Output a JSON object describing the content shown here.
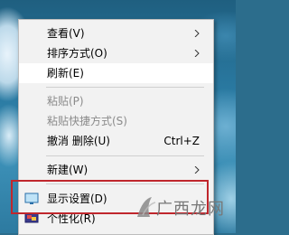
{
  "context_menu": {
    "items": [
      {
        "label": "查看(V)",
        "submenu": true
      },
      {
        "label": "排序方式(O)",
        "submenu": true
      },
      {
        "label": "刷新(E)"
      },
      {
        "label": "粘贴(P)",
        "disabled": true
      },
      {
        "label": "粘贴快捷方式(S)",
        "disabled": true
      },
      {
        "label": "撤消 删除(U)",
        "shortcut": "Ctrl+Z"
      },
      {
        "label": "新建(W)",
        "submenu": true
      },
      {
        "label": "显示设置(D)",
        "icon": "display-icon"
      },
      {
        "label": "个性化(R)",
        "icon": "personalize-icon"
      }
    ]
  },
  "watermark": {
    "text": "广西龙网"
  },
  "colors": {
    "highlight_border": "#c0272d",
    "menu_bg": "#f2f2f2",
    "disabled_text": "#8b8b8b"
  }
}
